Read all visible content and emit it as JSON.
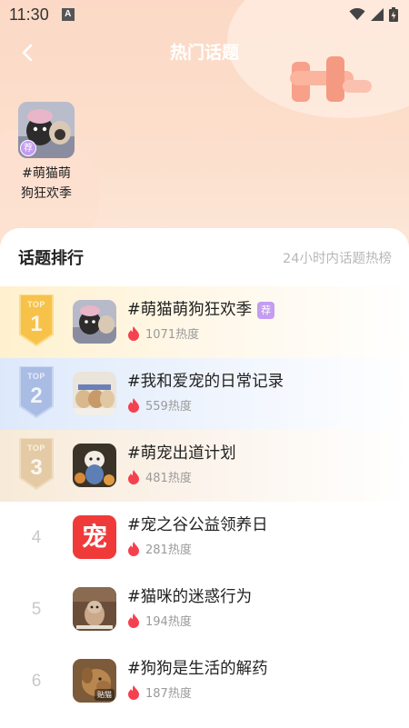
{
  "status_bar": {
    "time": "11:30",
    "notification_icon": "A"
  },
  "nav": {
    "title": "热门话题",
    "back_icon": "chevron-left-icon"
  },
  "featured": {
    "label": "#萌猫萌狗狂欢季",
    "badge": "荐"
  },
  "panel": {
    "title": "话题排行",
    "subtitle": "24小时内话题热榜"
  },
  "ranking": [
    {
      "rank": "1",
      "badge_top": "TOP",
      "title": "#萌猫萌狗狂欢季",
      "tag": "荐",
      "heat": "1071热度"
    },
    {
      "rank": "2",
      "badge_top": "TOP",
      "title": "#我和爱宠的日常记录",
      "tag": "",
      "heat": "559热度"
    },
    {
      "rank": "3",
      "badge_top": "TOP",
      "title": "#萌宠出道计划",
      "tag": "",
      "heat": "481热度"
    },
    {
      "rank": "4",
      "title": "#宠之谷公益领养日",
      "tag": "",
      "heat": "281热度",
      "thumb_text": "宠"
    },
    {
      "rank": "5",
      "title": "#猫咪的迷惑行为",
      "tag": "",
      "heat": "194热度"
    },
    {
      "rank": "6",
      "title": "#狗狗是生活的解药",
      "tag": "",
      "heat": "187热度",
      "thumb_tag": "贴猫"
    }
  ],
  "colors": {
    "accent_purple": "#c49cf2",
    "flame_red": "#f5414f",
    "gold": "#f7c24a",
    "silver": "#a9bce4",
    "bronze": "#e4cba5"
  }
}
